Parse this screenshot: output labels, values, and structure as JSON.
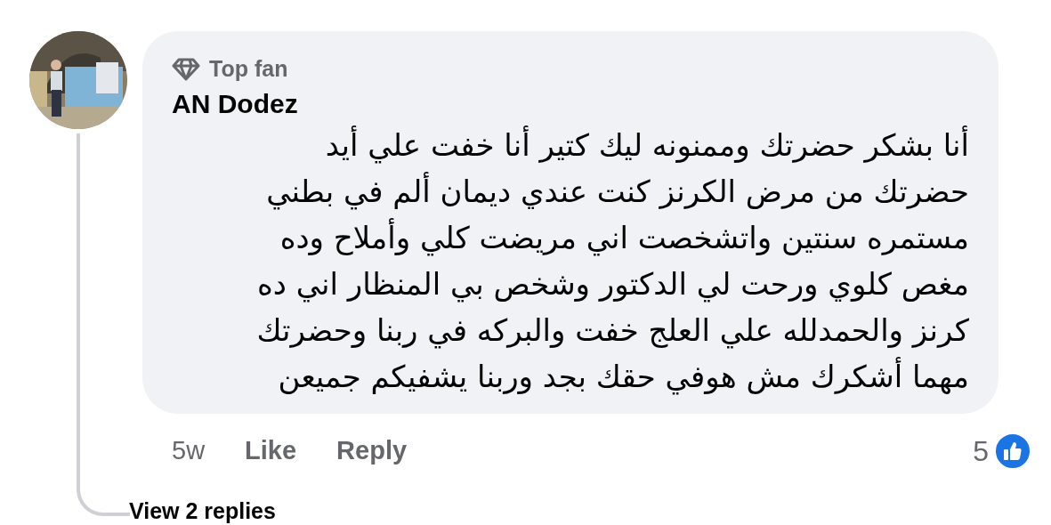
{
  "comment": {
    "badge": "Top fan",
    "author": "AN Dodez",
    "text": "أنا بشكر حضرتك وممنونه ليك كتير أنا خفت علي أيد\nحضرتك من مرض الكرنز كنت عندي ديمان ألم في بطني\nمستمره سنتين واتشخصت اني مريضت كلي وأملاح وده\nمغص كلوي ورحت لي الدكتور وشخص بي المنظار اني ده\nكرنز والحمدلله علي العلج  خفت والبركه في ربنا وحضرتك\nمهما أشكرك مش هوفي حقك بجد وربنا يشفيكم جميعن",
    "time": "5w",
    "like_label": "Like",
    "reply_label": "Reply",
    "reaction_count": "5"
  },
  "view_replies": "View 2 replies"
}
